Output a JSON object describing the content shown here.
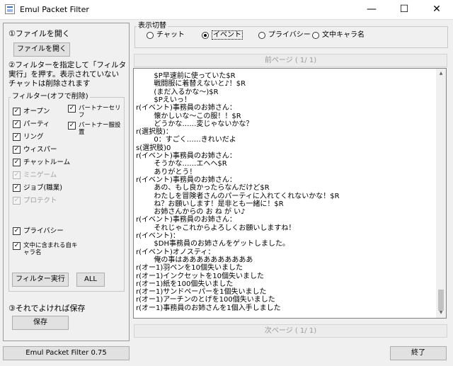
{
  "window": {
    "title": "Emul Packet Filter",
    "minimize": "—",
    "maximize": "☐",
    "close": "✕"
  },
  "left": {
    "step1": "①ファイルを開く",
    "open_button": "ファイルを開く",
    "step2_line1": "②フィルターを指定して「フィルター",
    "step2_line2": "実行」を押す。表示されていない",
    "step2_line3": "チャットは削除されます",
    "filter_group_title": "フィルター(オフで削除)",
    "filters": [
      {
        "label": "オープン",
        "checked": true,
        "enabled": true
      },
      {
        "label": "パーティ",
        "checked": true,
        "enabled": true
      },
      {
        "label": "リング",
        "checked": true,
        "enabled": true
      },
      {
        "label": "ウィスパー",
        "checked": true,
        "enabled": true
      },
      {
        "label": "チャットルーム",
        "checked": true,
        "enabled": true
      },
      {
        "label": "ミニゲーム",
        "checked": true,
        "enabled": false
      },
      {
        "label": "ジョブ(職業)",
        "checked": true,
        "enabled": true
      },
      {
        "label": "プロテクト",
        "checked": true,
        "enabled": false
      }
    ],
    "filters_right": [
      {
        "label": "パートナーセリフ",
        "checked": true
      },
      {
        "label": "パートナー服設置",
        "checked": true
      }
    ],
    "privacy_label": "プライバシー",
    "privacy_checked": true,
    "charname_label": "文中に含まれる自キャラ名",
    "charname_checked": true,
    "run_filter_button": "フィルター実行",
    "all_button": "ALL",
    "step3": "③それでよければ保存",
    "save_button": "保存",
    "version_button": "Emul Packet Filter 0.75"
  },
  "right": {
    "display_group_title": "表示切替",
    "radios": [
      {
        "label": "チャット",
        "selected": false
      },
      {
        "label": "イベント",
        "selected": true
      },
      {
        "label": "プライバシー",
        "selected": false
      },
      {
        "label": "文中キャラ名",
        "selected": false
      }
    ],
    "prev_page": "前ページ ( 1/ 1)",
    "next_page": "次ページ ( 1/ 1)",
    "exit_button": "終了",
    "lines": [
      "        $P早速前に使っていた$R",
      "        戦闘服に着替えないと♪！$R",
      "        (まだ入るかな〜)$R",
      "        $Pえいっ！",
      "r(イベント)事務員のお姉さん：",
      "        懐かしいな〜この服！！$R",
      "        どうかな……変じゃないかな？",
      "r(選択肢)：",
      "        0：すごく……きれいだよ",
      "s(選択肢)0",
      "r(イベント)事務員のお姉さん：",
      "        そうかな……エヘヘ$R",
      "        ありがとう！",
      "r(イベント)事務員のお姉さん：",
      "        あの、もし良かったらなんだけど$R",
      "        わたしを冒険者さんのパーティに入れてくれないかな！$R",
      "        ね？お願いします！是非とも一緒に！$R",
      "        お姉さんからの お ね が い♪",
      "r(イベント)事務員のお姉さん：",
      "        それじゃこれからよろしくお願いしますね！",
      "r(イベント)：",
      "        $DH事務員のお姉さんをゲットしました。",
      "r(イベント)オノスティ：",
      "        俺の事はああああああああああ",
      "r(オー1)羽ペンを10個失いました",
      "r(オー1)インクセットを10個失いました",
      "r(オー1)紙を100個失いました",
      "r(オー1)サンドペーパーを1個失いました",
      "r(オー1)アーチンのとげを100個失いました",
      "r(オー1)事務員のお姉さんを1個入手しました"
    ]
  }
}
